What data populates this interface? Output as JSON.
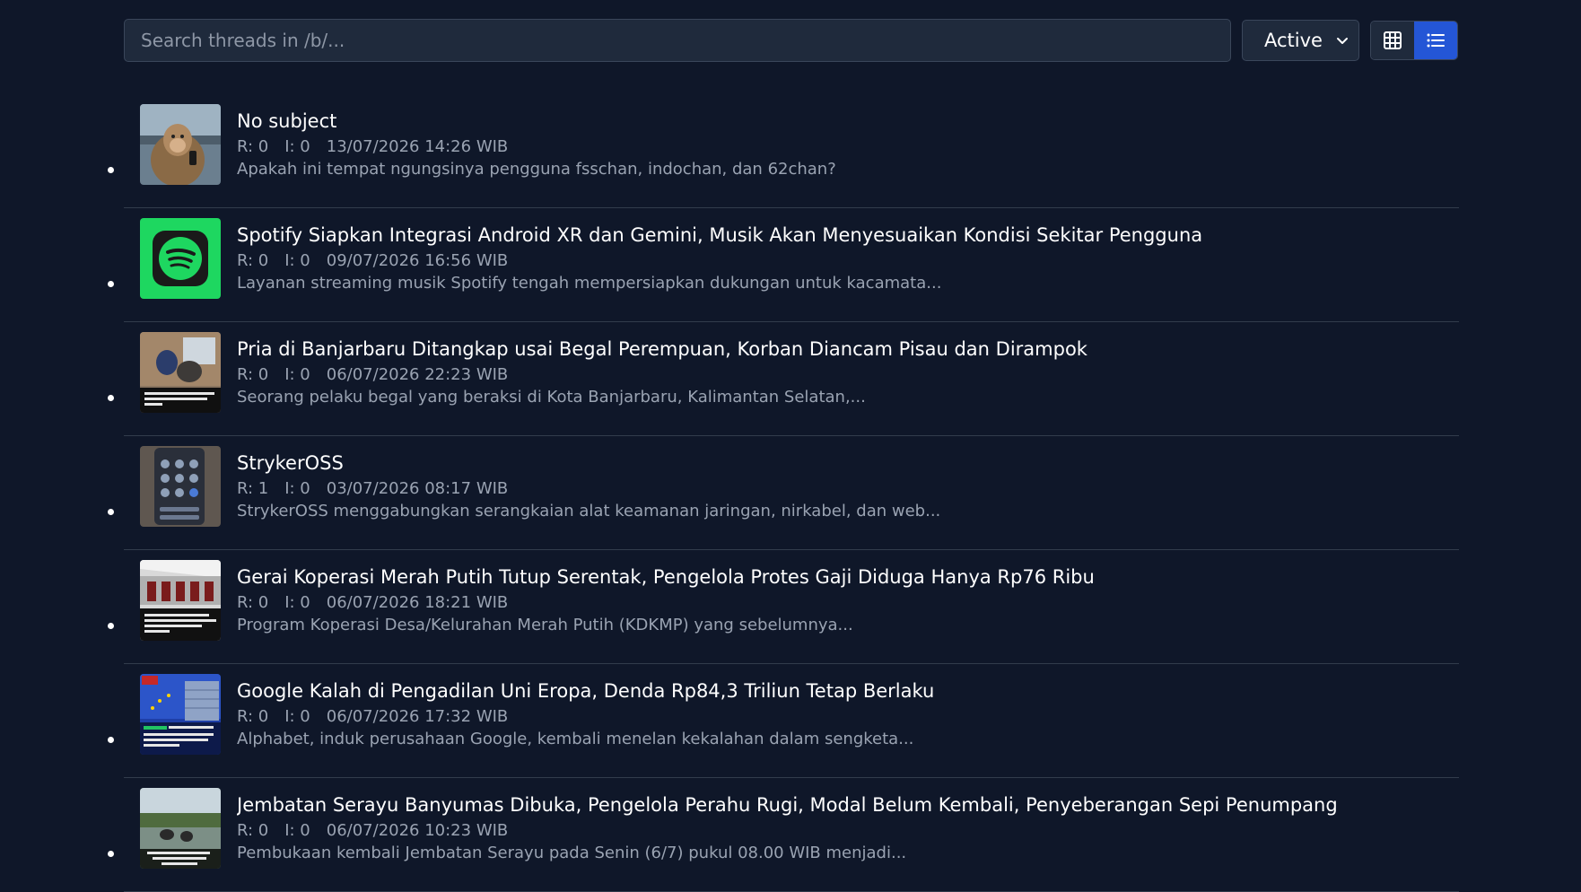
{
  "search": {
    "placeholder": "Search threads in /b/..."
  },
  "sort": {
    "selected": "Active"
  },
  "view": {
    "grid_icon": "grid-icon",
    "list_icon": "list-icon",
    "active": "list"
  },
  "colors": {
    "background": "#0f1729",
    "accent": "#2456d6",
    "muted_text": "#9aa3b2"
  },
  "threads": [
    {
      "title": "No subject",
      "replies": "R: 0",
      "images": "I: 0",
      "date": "13/07/2026 14:26 WIB",
      "excerpt": "Apakah ini tempat ngungsinya pengguna fsschan, indochan, dan 62chan?"
    },
    {
      "title": "Spotify Siapkan Integrasi Android XR dan Gemini, Musik Akan Menyesuaikan Kondisi Sekitar Pengguna",
      "replies": "R: 0",
      "images": "I: 0",
      "date": "09/07/2026 16:56 WIB",
      "excerpt": "Layanan streaming musik Spotify tengah mempersiapkan dukungan untuk kacamata..."
    },
    {
      "title": "Pria di Banjarbaru Ditangkap usai Begal Perempuan, Korban Diancam Pisau dan Dirampok",
      "replies": "R: 0",
      "images": "I: 0",
      "date": "06/07/2026 22:23 WIB",
      "excerpt": "Seorang pelaku begal yang beraksi di Kota Banjarbaru, Kalimantan Selatan,..."
    },
    {
      "title": "StrykerOSS",
      "replies": "R: 1",
      "images": "I: 0",
      "date": "03/07/2026 08:17 WIB",
      "excerpt": "StrykerOSS menggabungkan serangkaian alat keamanan jaringan, nirkabel, dan web..."
    },
    {
      "title": "Gerai Koperasi Merah Putih Tutup Serentak, Pengelola Protes Gaji Diduga Hanya Rp76 Ribu",
      "replies": "R: 0",
      "images": "I: 0",
      "date": "06/07/2026 18:21 WIB",
      "excerpt": "Program Koperasi Desa/Kelurahan Merah Putih (KDKMP) yang sebelumnya..."
    },
    {
      "title": "Google Kalah di Pengadilan Uni Eropa, Denda Rp84,3 Triliun Tetap Berlaku",
      "replies": "R: 0",
      "images": "I: 0",
      "date": "06/07/2026 17:32 WIB",
      "excerpt": "Alphabet, induk perusahaan Google, kembali menelan kekalahan dalam sengketa..."
    },
    {
      "title": "Jembatan Serayu Banyumas Dibuka, Pengelola Perahu Rugi, Modal Belum Kembali, Penyeberangan Sepi Penumpang",
      "replies": "R: 0",
      "images": "I: 0",
      "date": "06/07/2026 10:23 WIB",
      "excerpt": "Pembukaan kembali Jembatan Serayu pada Senin (6/7) pukul 08.00 WIB menjadi..."
    }
  ]
}
